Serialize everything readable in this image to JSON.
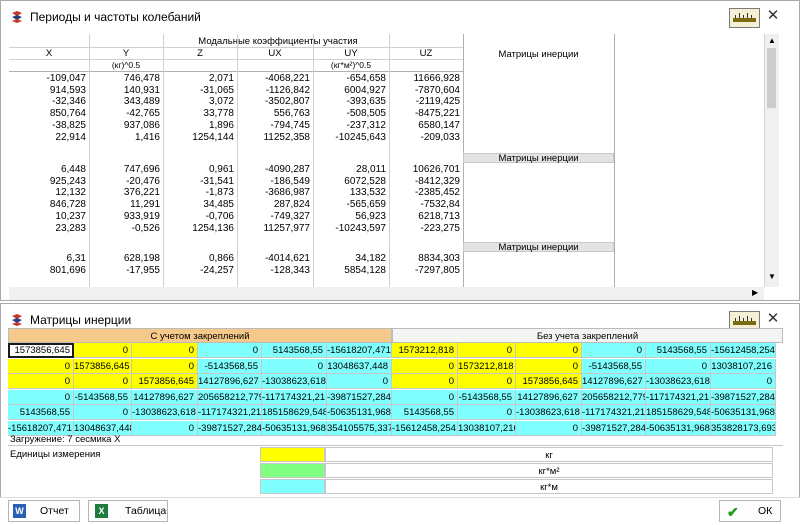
{
  "window1": {
    "title": "Периоды и частоты колебаний",
    "group_header": "Модальные коэффициенты участия",
    "columns": [
      "X",
      "Y",
      "Z",
      "UX",
      "UY",
      "UZ"
    ],
    "units_trans": "(кг)^0.5",
    "units_rot": "(кг*м²)^0.5",
    "side_header": "Матрицы инерции",
    "band_label": "Матрицы инерции",
    "rows_group1": [
      [
        "-109,047",
        "746,478",
        "2,071",
        "-4068,221",
        "-654,658",
        "11666,928"
      ],
      [
        "914,593",
        "140,931",
        "-31,065",
        "-1126,842",
        "6004,927",
        "-7870,604"
      ],
      [
        "-32,346",
        "343,489",
        "3,072",
        "-3502,807",
        "-393,635",
        "-2119,425"
      ],
      [
        "850,764",
        "-42,765",
        "33,778",
        "556,763",
        "-508,505",
        "-8475,221"
      ],
      [
        "-38,825",
        "937,086",
        "1,896",
        "-794,745",
        "-237,312",
        "6580,147"
      ],
      [
        "22,914",
        "1,416",
        "1254,144",
        "11252,358",
        "-10245,643",
        "-209,033"
      ]
    ],
    "rows_group2": [
      [
        "6,448",
        "747,696",
        "0,961",
        "-4090,287",
        "28,011",
        "10626,701"
      ],
      [
        "925,243",
        "-20,476",
        "-31,541",
        "-186,549",
        "6072,528",
        "-8412,329"
      ],
      [
        "12,132",
        "376,221",
        "-1,873",
        "-3686,987",
        "133,532",
        "-2385,452"
      ],
      [
        "846,728",
        "11,291",
        "34,485",
        "287,824",
        "-565,659",
        "-7532,84"
      ],
      [
        "10,237",
        "933,919",
        "-0,706",
        "-749,327",
        "56,923",
        "6218,713"
      ],
      [
        "23,283",
        "-0,526",
        "1254,136",
        "11257,977",
        "-10243,597",
        "-223,275"
      ]
    ],
    "rows_group3": [
      [
        "6,31",
        "628,198",
        "0,866",
        "-4014,621",
        "34,182",
        "8834,303"
      ],
      [
        "801,696",
        "-17,955",
        "-24,257",
        "-128,343",
        "5854,128",
        "-7297,805"
      ]
    ]
  },
  "window2": {
    "title": "Матрицы инерции",
    "header_left": "С учетом закреплений",
    "header_right": "Без учета закреплений",
    "matrix_left": [
      [
        "1573856,645",
        "0",
        "0",
        "0",
        "5143568,55",
        "-15618207,471"
      ],
      [
        "0",
        "1573856,645",
        "0",
        "-5143568,55",
        "0",
        "13048637,448"
      ],
      [
        "0",
        "0",
        "1573856,645",
        "14127896,627",
        "-13038623,618",
        "0"
      ],
      [
        "0",
        "-5143568,55",
        "14127896,627",
        "205658212,779",
        "-117174321,21",
        "-39871527,284"
      ],
      [
        "5143568,55",
        "0",
        "-13038623,618",
        "-117174321,21",
        "185158629,548",
        "-50635131,968"
      ],
      [
        "-15618207,471",
        "13048637,448",
        "0",
        "-39871527,284",
        "-50635131,968",
        "354105575,337"
      ]
    ],
    "matrix_right": [
      [
        "1573212,818",
        "0",
        "0",
        "0",
        "5143568,55",
        "-15612458,254"
      ],
      [
        "0",
        "1573212,818",
        "0",
        "-5143568,55",
        "0",
        "13038107,216"
      ],
      [
        "0",
        "0",
        "1573856,645",
        "14127896,627",
        "-13038623,618",
        "0"
      ],
      [
        "0",
        "-5143568,55",
        "14127896,627",
        "205658212,779",
        "-117174321,21",
        "-39871527,284"
      ],
      [
        "5143568,55",
        "0",
        "-13038623,618",
        "-117174321,21",
        "185158629,548",
        "-50635131,968"
      ],
      [
        "-15612458,254",
        "13038107,216",
        "0",
        "-39871527,284",
        "-50635131,968",
        "353828173,693"
      ]
    ],
    "loading": "Загружение: 7 сесмика X",
    "units_label": "Единицы измерения",
    "unit_rows": [
      "кг",
      "кг*м²",
      "кг*м"
    ],
    "colors": {
      "yellow": "#ffff00",
      "green": "#80ff80",
      "cyan": "#80ffff",
      "header_left": "#f5c98a"
    }
  },
  "buttons": {
    "report": "Отчет",
    "table": "Таблица",
    "ok": "ОК"
  }
}
